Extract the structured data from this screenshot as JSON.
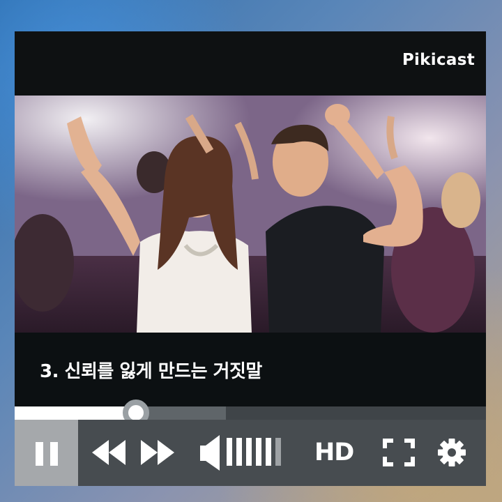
{
  "app": {
    "logo": "Pikicast"
  },
  "video": {
    "description_icon": "video-frame"
  },
  "caption": {
    "text": "3. 신뢰를 잃게 만드는 거짓말"
  },
  "progress": {
    "played_fraction": 0.258,
    "buffered_fraction": 0.448
  },
  "controls": {
    "pause_icon": "pause-icon",
    "rewind_icon": "rewind-icon",
    "fast_forward_icon": "fast-forward-icon",
    "volume_icon": "volume-icon",
    "volume_level": 0.75,
    "quality_label": "HD",
    "fullscreen_icon": "fullscreen-icon",
    "settings_icon": "gear-icon"
  },
  "colors": {
    "player_bg": "#0e1011",
    "controls_bg": "#474c50",
    "pause_bg": "#a5a8ab",
    "text": "#ffffff",
    "volume_inactive": "#9ea2a5"
  }
}
